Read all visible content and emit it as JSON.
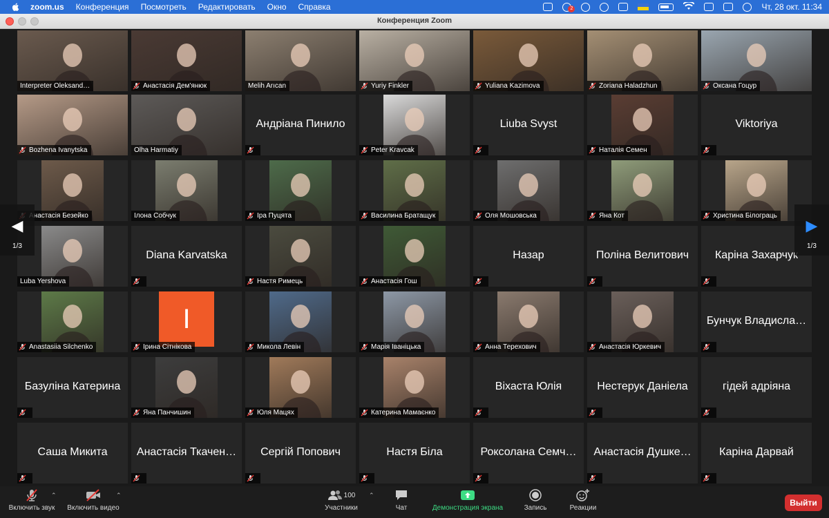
{
  "menubar": {
    "app_name": "zoom.us",
    "items": [
      "Конференция",
      "Посмотреть",
      "Редактировать",
      "Окно",
      "Справка"
    ],
    "notification_count": "2",
    "clock": "Чт, 28 окт.  11:34"
  },
  "window": {
    "title": "Конференция Zoom"
  },
  "nav": {
    "left_page": "1/3",
    "right_page": "1/3"
  },
  "tiles": [
    {
      "name": "Interpreter Oleksand…",
      "video": true,
      "muted": false,
      "color": "#6a5a4e"
    },
    {
      "name": "Анастасія Дем'янюк",
      "video": true,
      "muted": true,
      "color": "#4a3a34"
    },
    {
      "name": "Melih Arıcan",
      "video": true,
      "muted": false,
      "active": true,
      "color": "#8c7f70"
    },
    {
      "name": "Yuriy Finkler",
      "video": true,
      "muted": true,
      "color": "#b9b0a3"
    },
    {
      "name": "Yuliana Kazimova",
      "video": true,
      "muted": true,
      "color": "#7a5a3a"
    },
    {
      "name": "Zoriana Haladzhun",
      "video": true,
      "muted": true,
      "color": "#a48f74"
    },
    {
      "name": "Оксана Гоцур",
      "video": true,
      "muted": true,
      "color": "#9aa6b0"
    },
    {
      "name": "Bozhena Ivanytska",
      "video": true,
      "muted": true,
      "color": "#b59a87"
    },
    {
      "name": "Olha Harmatiy",
      "video": true,
      "muted": false,
      "color": "#5d5a58"
    },
    {
      "name": "Андріана Пинило",
      "video": false,
      "muted": true,
      "color": ""
    },
    {
      "name": "Peter Kravcak",
      "video": true,
      "muted": true,
      "color": "#d9d9d9"
    },
    {
      "name": "Liuba Svyst",
      "video": false,
      "muted": true,
      "color": ""
    },
    {
      "name": "Наталія Семен",
      "video": true,
      "muted": true,
      "color": "#5a3d33"
    },
    {
      "name": "Viktoriya",
      "video": false,
      "muted": true,
      "color": ""
    },
    {
      "name": "Анастасія Безейко",
      "video": true,
      "muted": true,
      "color": "#6d5a4a"
    },
    {
      "name": "Ілона Собчук",
      "video": true,
      "muted": false,
      "color": "#7b7d6f"
    },
    {
      "name": "Іра Пуцята",
      "video": true,
      "muted": true,
      "color": "#4d6b4a"
    },
    {
      "name": "Василина Братащук",
      "video": true,
      "muted": true,
      "color": "#5f6e48"
    },
    {
      "name": "Оля Мошовська",
      "video": true,
      "muted": true,
      "color": "#6e6e6e"
    },
    {
      "name": "Яна Кот",
      "video": true,
      "muted": true,
      "color": "#8f9c7a"
    },
    {
      "name": "Христина Білограць",
      "video": true,
      "muted": true,
      "color": "#b8a58a"
    },
    {
      "name": "Luba Yershova",
      "video": true,
      "muted": false,
      "color": "#8a8a8a"
    },
    {
      "name": "Diana Karvatska",
      "video": false,
      "muted": true,
      "color": ""
    },
    {
      "name": "Настя Римець",
      "video": true,
      "muted": true,
      "color": "#4b4b3f"
    },
    {
      "name": "Анастасія Гош",
      "video": true,
      "muted": true,
      "color": "#3f5a36"
    },
    {
      "name": "Назар",
      "video": false,
      "muted": true,
      "color": ""
    },
    {
      "name": "Поліна Велитович",
      "video": false,
      "muted": true,
      "color": ""
    },
    {
      "name": "Каріна Захарчук",
      "video": false,
      "muted": true,
      "color": ""
    },
    {
      "name": "Anastasiia Silchenko",
      "video": true,
      "muted": true,
      "color": "#5d7a48"
    },
    {
      "name": "Ірина Сітнікова",
      "video": false,
      "muted": true,
      "avatar": "І",
      "color": ""
    },
    {
      "name": "Микола Левін",
      "video": true,
      "muted": true,
      "color": "#4f6a8a"
    },
    {
      "name": "Марія Іваніцька",
      "video": true,
      "muted": true,
      "color": "#8d98a6"
    },
    {
      "name": "Анна Терехович",
      "video": true,
      "muted": true,
      "color": "#8a7a6e"
    },
    {
      "name": "Анастасія Юркевич",
      "video": true,
      "muted": true,
      "color": "#6a5f5a"
    },
    {
      "name": "Бунчук Владисла…",
      "video": false,
      "muted": true,
      "color": ""
    },
    {
      "name": "Базуліна Катерина",
      "video": false,
      "muted": true,
      "color": ""
    },
    {
      "name": "Яна Панчишин",
      "video": true,
      "muted": true,
      "color": "#3d3d3d"
    },
    {
      "name": "Юля Мацях",
      "video": true,
      "muted": true,
      "color": "#a07a5a"
    },
    {
      "name": "Катерина Мамаєнко",
      "video": true,
      "muted": true,
      "color": "#a8826a"
    },
    {
      "name": "Віхаста Юлія",
      "video": false,
      "muted": true,
      "color": ""
    },
    {
      "name": "Нестерук Даніела",
      "video": false,
      "muted": true,
      "color": ""
    },
    {
      "name": "гідей адріяна",
      "video": false,
      "muted": true,
      "color": ""
    },
    {
      "name": "Саша Микита",
      "video": false,
      "muted": true,
      "color": ""
    },
    {
      "name": "Анастасія Ткачен…",
      "video": false,
      "muted": true,
      "color": ""
    },
    {
      "name": "Сергій Попович",
      "video": false,
      "muted": true,
      "color": ""
    },
    {
      "name": "Настя Біла",
      "video": false,
      "muted": true,
      "color": ""
    },
    {
      "name": "Роксолана Семч…",
      "video": false,
      "muted": true,
      "color": ""
    },
    {
      "name": "Анастасія Душке…",
      "video": false,
      "muted": true,
      "color": ""
    },
    {
      "name": "Каріна Дарвай",
      "video": false,
      "muted": true,
      "color": ""
    }
  ],
  "toolbar": {
    "unmute_label": "Включить звук",
    "video_label": "Включить видео",
    "participants_label": "Участники",
    "participants_count": "100",
    "chat_label": "Чат",
    "share_label": "Демонстрация экрана",
    "record_label": "Запись",
    "reactions_label": "Реакции",
    "leave_label": "Выйти"
  },
  "colors": {
    "accent_active": "#9acd32",
    "share_green": "#3ddc84",
    "leave_red": "#d32f2f",
    "menubar_blue": "#2b6fd6"
  }
}
